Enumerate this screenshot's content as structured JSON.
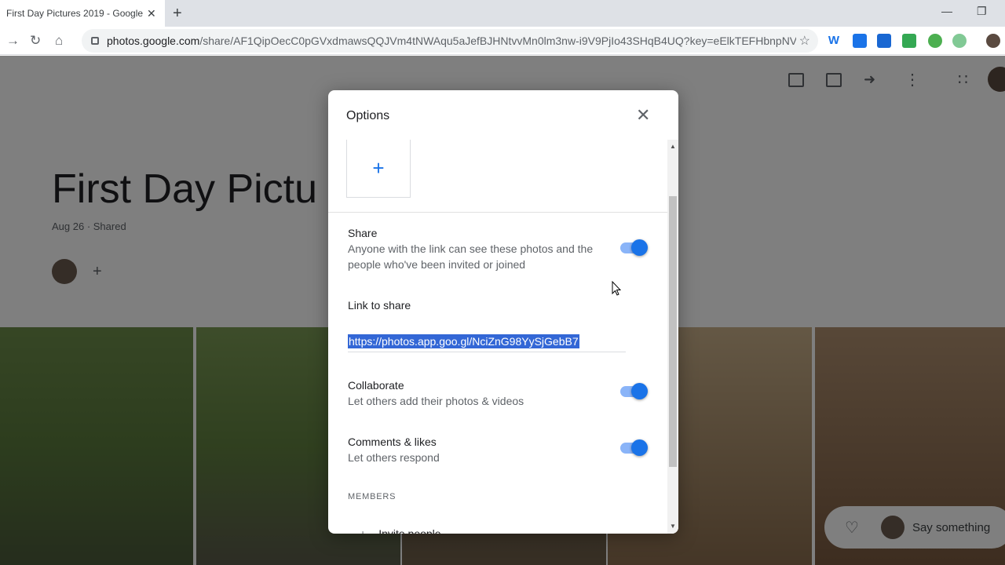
{
  "browser": {
    "tab_title": "First Day Pictures 2019 - Google",
    "tab_close": "✕",
    "new_tab": "+",
    "url_host": "photos.google.com",
    "url_path": "/share/AF1QipOecC0pGVxdmawsQQJVm4tNWAqu5aJefBJHNtvvMn0lm3nw-i9V9PjIo43SHqB4UQ?key=eElkTEFHbnpNV...",
    "extensions": [
      {
        "name": "w-extension",
        "color": "#1a73e8"
      },
      {
        "name": "edit-extension",
        "color": "#1a73e8"
      },
      {
        "name": "calendar-extension",
        "color": "#1967d2"
      },
      {
        "name": "green-extension",
        "color": "#34a853"
      },
      {
        "name": "red-badge-extension",
        "color": "#4caf50"
      },
      {
        "name": "green-circle-extension",
        "color": "#81c995"
      }
    ]
  },
  "album": {
    "title": "First Day Pictu",
    "meta": "Aug 26 · Shared"
  },
  "chat": {
    "placeholder": "Say something"
  },
  "dialog": {
    "title": "Options",
    "add_symbol": "+",
    "share": {
      "title": "Share",
      "desc": "Anyone with the link can see these photos and the people who've been invited or joined",
      "enabled": true
    },
    "link": {
      "title": "Link to share",
      "url": "https://photos.app.goo.gl/NciZnG98YySjGebB7"
    },
    "collaborate": {
      "title": "Collaborate",
      "desc": "Let others add their photos & videos",
      "enabled": true
    },
    "comments": {
      "title": "Comments & likes",
      "desc": "Let others respond",
      "enabled": true
    },
    "members_label": "MEMBERS",
    "invite_label": "Invite people"
  }
}
